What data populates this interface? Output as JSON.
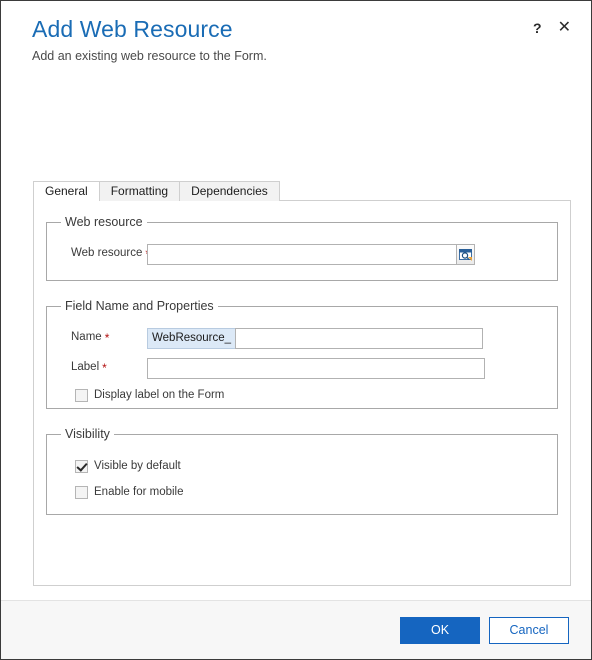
{
  "window": {
    "title": "Add Web Resource",
    "subtitle": "Add an existing web resource to the Form.",
    "help_label": "?",
    "close_label": "✕",
    "accent_color": "#1565c0",
    "title_color": "#1a6cb5",
    "required_color": "#b21010"
  },
  "tabs": [
    {
      "label": "General",
      "active": true
    },
    {
      "label": "Formatting",
      "active": false
    },
    {
      "label": "Dependencies",
      "active": false
    }
  ],
  "sections": {
    "web_resource": {
      "legend": "Web resource",
      "field_label": "Web resource",
      "required_mark": "*",
      "value": "",
      "placeholder": "",
      "lookup_icon": "lookup-browse-icon"
    },
    "field_name": {
      "legend": "Field Name and Properties",
      "name_label": "Name",
      "name_required_mark": "*",
      "name_prefix": "WebResource_",
      "name_value": "",
      "label_label": "Label",
      "label_required_mark": "*",
      "label_value": "",
      "display_label_checkbox": {
        "label": "Display label on the Form",
        "checked": false
      }
    },
    "visibility": {
      "legend": "Visibility",
      "visible_by_default": {
        "label": "Visible by default",
        "checked": true
      },
      "enable_for_mobile": {
        "label": "Enable for mobile",
        "checked": false
      }
    }
  },
  "footer": {
    "ok_label": "OK",
    "cancel_label": "Cancel"
  }
}
